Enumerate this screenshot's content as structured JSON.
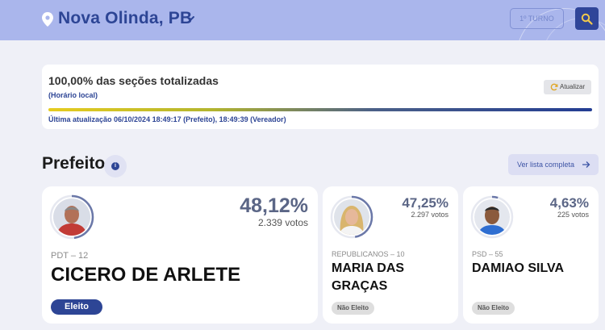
{
  "header": {
    "city": "Nova Olinda, PB",
    "turno_label": "1º TURNO"
  },
  "status": {
    "secoes_label": "100,00% das seções totalizadas",
    "horario_label": "(Horário local)",
    "progress": 1.0,
    "ultima_atualizacao": "Última atualização 06/10/2024 18:49:17 (Prefeito), 18:49:39 (Vereador)",
    "atualizar_label": "Atualizar"
  },
  "section": {
    "title": "Prefeito",
    "ver_lista_label": "Ver lista completa"
  },
  "candidates": [
    {
      "percent": "48,12%",
      "votes": "2.339 votos",
      "party": "PDT – 12",
      "name": "CICERO DE ARLETE",
      "status": "Eleito",
      "vote_share": 0.4812
    },
    {
      "percent": "47,25%",
      "votes": "2.297 votos",
      "party": "REPUBLICANOS – 10",
      "name_line1": "MARIA DAS",
      "name_line2": "GRAÇAS",
      "status": "Não Eleito",
      "vote_share": 0.4725
    },
    {
      "percent": "4,63%",
      "votes": "225 votos",
      "party": "PSD – 55",
      "name": "DAMIAO SILVA",
      "status": "Não Eleito",
      "vote_share": 0.0463
    }
  ],
  "colors": {
    "brand": "#2d4595",
    "topbar": "#aab6ec",
    "background": "#eff0f7",
    "percent_text": "#5b6686"
  },
  "icons": [
    "location-pin-icon",
    "chevron-down-icon",
    "search-icon",
    "refresh-icon",
    "info-icon",
    "arrow-right-icon"
  ]
}
